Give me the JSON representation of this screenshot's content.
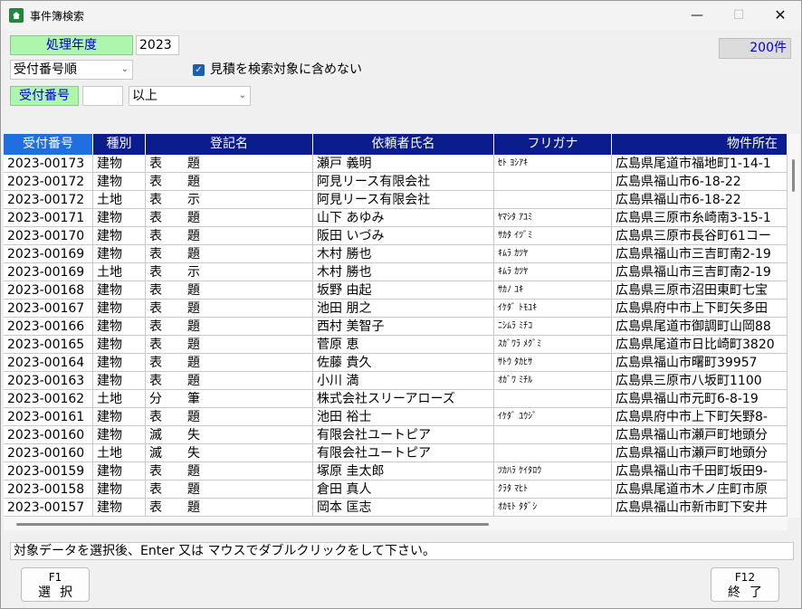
{
  "window": {
    "title": "事件簿検索",
    "minimize": "—",
    "maximize": "☐",
    "close": "✕"
  },
  "filters": {
    "year_label": "処理年度",
    "year_value": "2023",
    "sort_selected": "受付番号順",
    "checkbox_label": "見積を検索対象に含めない",
    "checkbox_checked": true,
    "number_label": "受付番号",
    "number_value": "",
    "condition_selected": "以上"
  },
  "result_count": "200件",
  "table": {
    "columns": [
      "受付番号",
      "種別",
      "登記名",
      "依頼者氏名",
      "フリガナ",
      "物件所在"
    ],
    "rows": [
      [
        "2023-00173",
        "建物",
        "表　　題",
        "瀬戸 義明",
        "ｾﾄ ﾖｼｱｷ",
        "広島県尾道市福地町1-14-1"
      ],
      [
        "2023-00172",
        "建物",
        "表　　題",
        "阿見リース有限会社",
        "",
        "広島県福山市6-18-22"
      ],
      [
        "2023-00172",
        "土地",
        "表　　示",
        "阿見リース有限会社",
        "",
        "広島県福山市6-18-22"
      ],
      [
        "2023-00171",
        "建物",
        "表　　題",
        "山下 あゆみ",
        "ﾔﾏｼﾀ ｱﾕﾐ",
        "広島県三原市糸崎南3-15-1"
      ],
      [
        "2023-00170",
        "建物",
        "表　　題",
        "阪田 いづみ",
        "ｻｶﾀ ｲﾂﾞﾐ",
        "広島県三原市長谷町61コー"
      ],
      [
        "2023-00169",
        "建物",
        "表　　題",
        "木村 勝也",
        "ｷﾑﾗ ｶﾂﾔ",
        "広島県福山市三吉町南2-19"
      ],
      [
        "2023-00169",
        "土地",
        "表　　示",
        "木村 勝也",
        "ｷﾑﾗ ｶﾂﾔ",
        "広島県福山市三吉町南2-19"
      ],
      [
        "2023-00168",
        "建物",
        "表　　題",
        "坂野 由起",
        "ｻｶﾉ ﾕｷ",
        "広島県三原市沼田東町七宝"
      ],
      [
        "2023-00167",
        "建物",
        "表　　題",
        "池田 朋之",
        "ｲｹﾀﾞ ﾄﾓﾕｷ",
        "広島県府中市上下町矢多田"
      ],
      [
        "2023-00166",
        "建物",
        "表　　題",
        "西村 美智子",
        "ﾆｼﾑﾗ ﾐﾁｺ",
        "広島県尾道市御調町山岡88"
      ],
      [
        "2023-00165",
        "建物",
        "表　　題",
        "菅原 恵",
        "ｽｶﾞﾜﾗ ﾒｸﾞﾐ",
        "広島県尾道市日比崎町3820"
      ],
      [
        "2023-00164",
        "建物",
        "表　　題",
        "佐藤 貴久",
        "ｻﾄｳ ﾀｶﾋｻ",
        "広島県福山市曙町39957"
      ],
      [
        "2023-00163",
        "建物",
        "表　　題",
        "小川 満",
        "ｵｶﾞﾜ ﾐﾁﾙ",
        "広島県三原市八坂町1100"
      ],
      [
        "2023-00162",
        "土地",
        "分　　筆",
        "株式会社スリーアローズ",
        "",
        "広島県福山市元町6-8-19"
      ],
      [
        "2023-00161",
        "建物",
        "表　　題",
        "池田 裕士",
        "ｲｹﾀﾞ ﾕｳｼﾞ",
        "広島県府中市上下町矢野8-"
      ],
      [
        "2023-00160",
        "建物",
        "滅　　失",
        "有限会社ユートピア",
        "",
        "広島県福山市瀬戸町地頭分"
      ],
      [
        "2023-00160",
        "土地",
        "滅　　失",
        "有限会社ユートピア",
        "",
        "広島県福山市瀬戸町地頭分"
      ],
      [
        "2023-00159",
        "建物",
        "表　　題",
        "塚原 圭太郎",
        "ﾂｶﾊﾗ ｹｲﾀﾛｳ",
        "広島県福山市千田町坂田9-"
      ],
      [
        "2023-00158",
        "建物",
        "表　　題",
        "倉田 真人",
        "ｸﾗﾀ ﾏﾋﾄ",
        "広島県尾道市木ノ庄町市原"
      ],
      [
        "2023-00157",
        "建物",
        "表　　題",
        "岡本 匡志",
        "ｵｶﾓﾄ ﾀﾀﾞｼ",
        "広島県福山市新市町下安井"
      ]
    ]
  },
  "status_message": "対象データを選択後、Enter 又は マウスでダブルクリックをして下さい。",
  "function_keys": [
    {
      "key": "F1",
      "label": "選択"
    },
    {
      "key": "F12",
      "label": "終了"
    }
  ]
}
